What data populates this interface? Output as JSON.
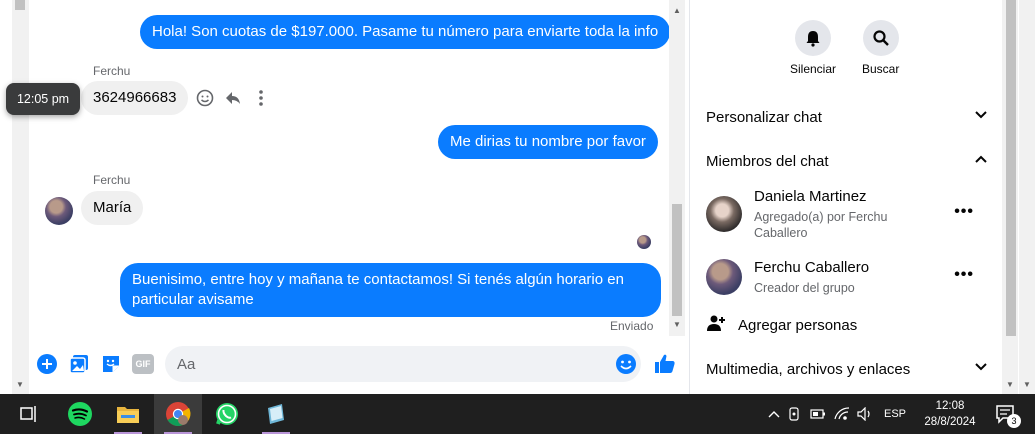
{
  "chat": {
    "messages": [
      {
        "text": "Hola! Son cuotas de $197.000. Pasame tu número para enviarte toda la info"
      },
      {
        "sender": "Ferchu",
        "text": "3624966683"
      },
      {
        "text": "Me dirias tu nombre por favor"
      },
      {
        "sender": "Ferchu",
        "text": "María"
      },
      {
        "text": "Buenisimo, entre hoy y mañana te contactamos! Si tenés algún horario en particular avisame"
      }
    ],
    "tooltip_time": "12:05 pm",
    "status": "Enviado",
    "composer_placeholder": "Aa",
    "gif_label": "GIF"
  },
  "panel": {
    "actions": [
      {
        "label": "Silenciar",
        "icon": "bell-icon"
      },
      {
        "label": "Buscar",
        "icon": "search-icon"
      }
    ],
    "sections": {
      "customize": "Personalizar chat",
      "members": "Miembros del chat",
      "media": "Multimedia, archivos y enlaces"
    },
    "members": [
      {
        "name": "Daniela Martinez",
        "sub": "Agregado(a) por Ferchu Caballero"
      },
      {
        "name": "Ferchu Caballero",
        "sub": "Creador del grupo"
      }
    ],
    "add_people": "Agregar personas"
  },
  "taskbar": {
    "language": "ESP",
    "time": "12:08",
    "date": "28/8/2024",
    "notifications": "3"
  },
  "colors": {
    "accent": "#0a7cff",
    "bubble_in": "#f0f0f0",
    "taskbar": "#1f1f1f"
  }
}
